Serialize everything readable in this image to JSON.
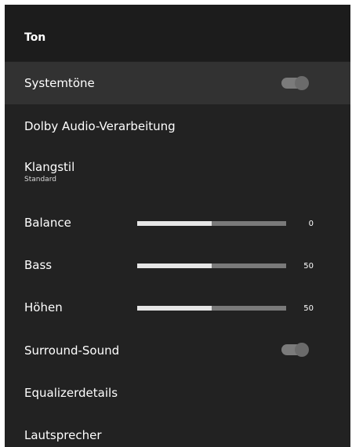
{
  "header": {
    "title": "Ton"
  },
  "items": {
    "system_sounds": {
      "label": "Systemtöne",
      "enabled": true
    },
    "dolby": {
      "label": "Dolby Audio-Verarbeitung"
    },
    "sound_style": {
      "label": "Klangstil",
      "value": "Standard"
    },
    "balance": {
      "label": "Balance",
      "value": "0",
      "level": 0.5
    },
    "bass": {
      "label": "Bass",
      "value": "50",
      "level": 0.5
    },
    "treble": {
      "label": "Höhen",
      "value": "50",
      "level": 0.5
    },
    "surround": {
      "label": "Surround-Sound",
      "enabled": true
    },
    "equalizer": {
      "label": "Equalizerdetails"
    },
    "speakers": {
      "label": "Lautsprecher"
    }
  },
  "colors": {
    "background": "#222222",
    "header": "#1c1c1c",
    "selected_row": "#323232",
    "slider_fill": "#e6e6e6",
    "slider_track": "#7a7a7a"
  }
}
